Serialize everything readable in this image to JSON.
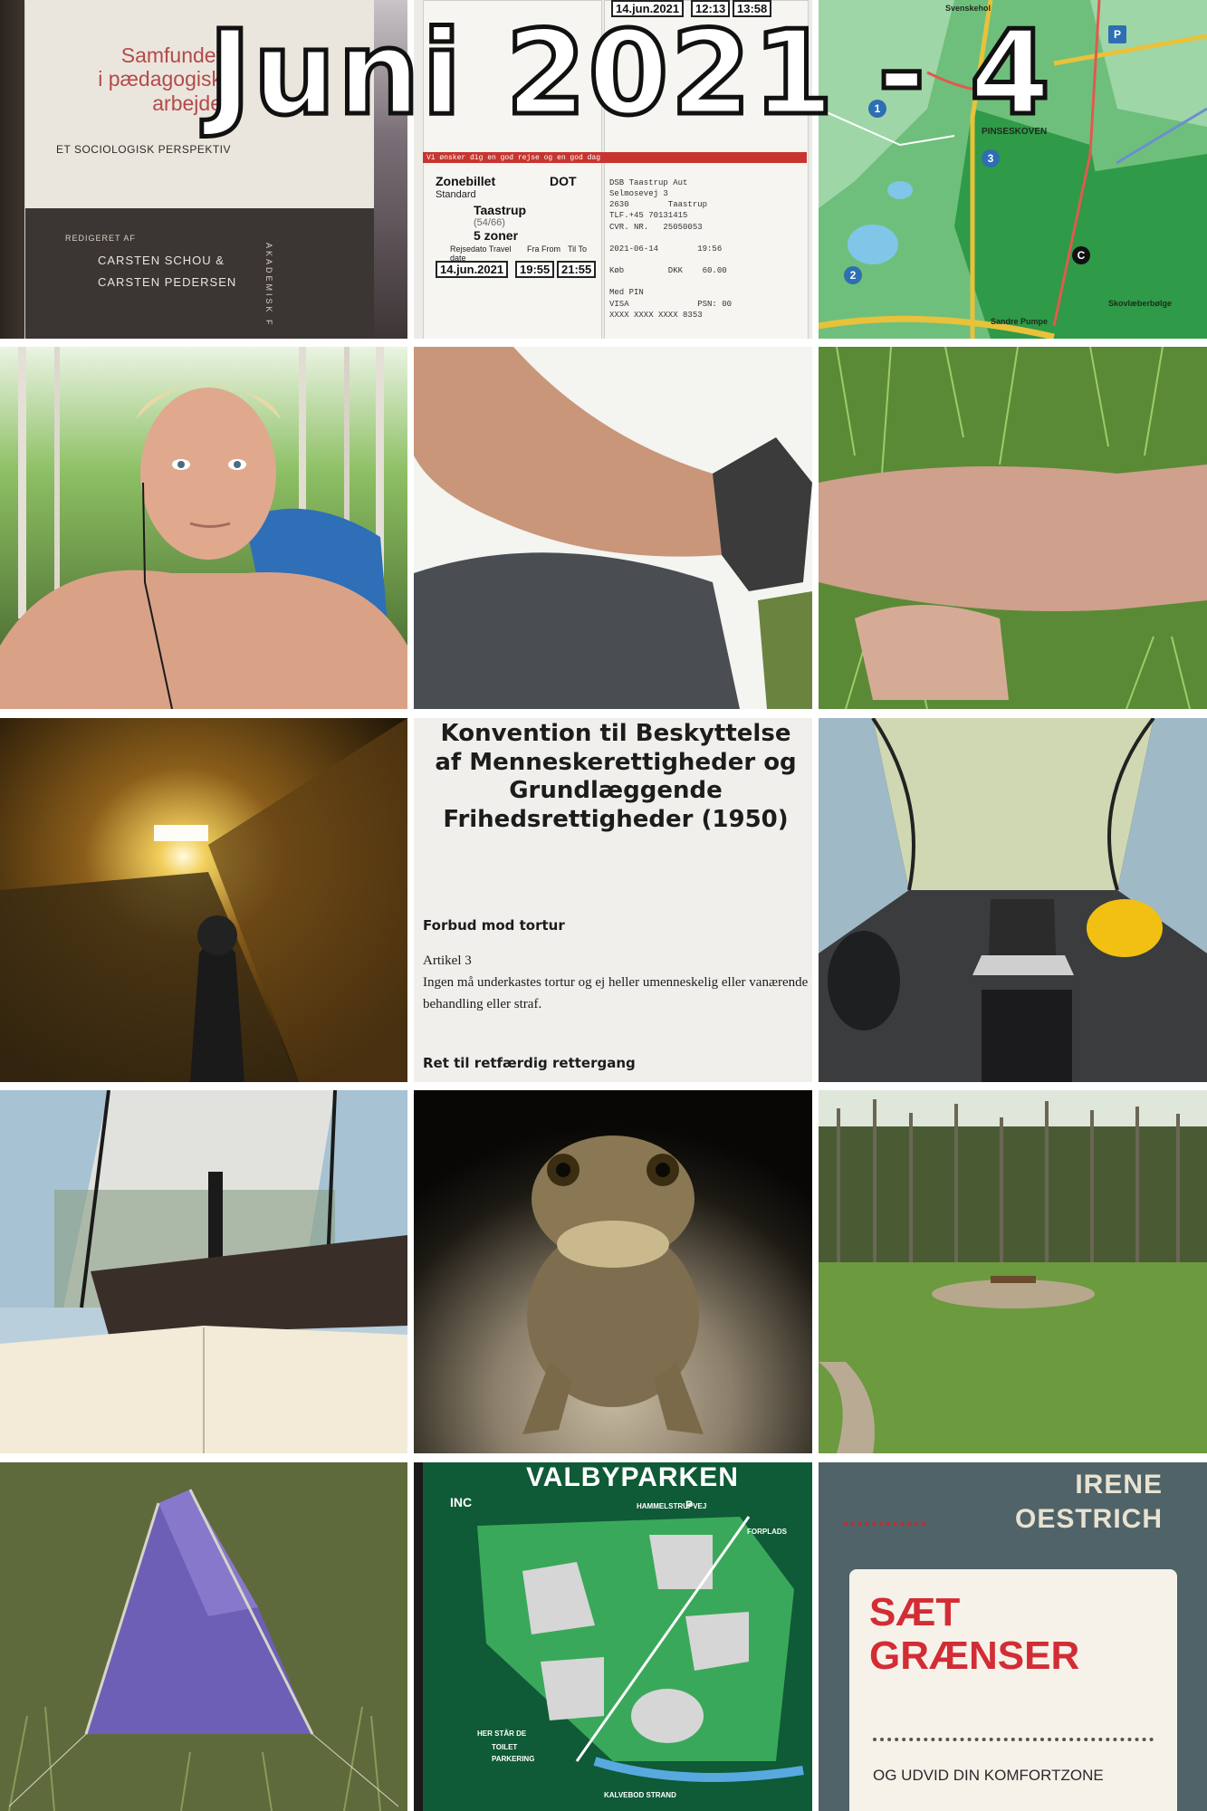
{
  "headline": "Juni 2021 - 4",
  "tiles": {
    "book1": {
      "title_line1": "Samfundet",
      "title_line2": "i pædagogisk",
      "title_line3": "arbejde",
      "subtitle": "ET SOCIOLOGISK PERSPEKTIV",
      "redigeret": "REDIGERET AF",
      "editor1": "CARSTEN SCHOU &",
      "editor2": "CARSTEN PEDERSEN",
      "publisher": "AKADEMISK F"
    },
    "tickets": {
      "date": "14.jun.2021",
      "time1": "12:13",
      "time2": "13:58",
      "ticket_type": "Zonebillet",
      "ticket_class": "Standard",
      "operator": "DOT",
      "from": "Taastrup",
      "from_zone": "(54/66)",
      "zones": "5 zoner",
      "travel_date_label": "Rejsedato Travel date",
      "from_label": "Fra From",
      "to_label": "Til To",
      "travel_date": "14.jun.2021",
      "dep": "19:55",
      "arr": "21:55",
      "warning": "Vi ønsker dig en god rejse og en god dag",
      "receipt": "DSB Taastrup Aut\nSelmosevej 3\n2630        Taastrup\nTLF.+45 70131415\nCVR. NR.   25050053\n\n2021-06-14        19:56\n\nKøb         DKK    60.00\n\nMed PIN\nVISA              PSN: 00\nXXXX XXXX XXXX 8353"
    },
    "map": {
      "place1": "PINSESKOVEN",
      "place2": "Svenskehol",
      "place3": "Skovlæberbølge",
      "place4": "Sandre Pumpe",
      "num1": "1",
      "num2": "2",
      "num3": "3",
      "letter": "C",
      "parking": "P"
    },
    "document": {
      "heading": "Konvention til Beskyttelse af Menneskerettigheder og Grundlæggende Frihedsrettigheder (1950)",
      "section": "Forbud mod tortur",
      "article": "Artikel 3",
      "text": "Ingen må underkastes tortur og ej heller umenneskelig eller vanærende behandling eller straf.",
      "section2": "Ret til retfærdig rettergang"
    },
    "park": {
      "title": "VALBYPARKEN",
      "road": "HAMMELSTRUPVEJ",
      "entrance": "FORPLADS",
      "logo": "INC",
      "p_label": "P",
      "toilet": "TOILET",
      "parking": "PARKERING",
      "shore": "KALVEBOD STRAND",
      "legend": "HER STÅR DE"
    },
    "book2": {
      "author_line1": "IRENE",
      "author_line2": "OESTRICH",
      "title_line1": "SÆT",
      "title_line2": "GRÆNSER",
      "subtitle": "OG UDVID DIN KOMFORTZONE"
    }
  }
}
